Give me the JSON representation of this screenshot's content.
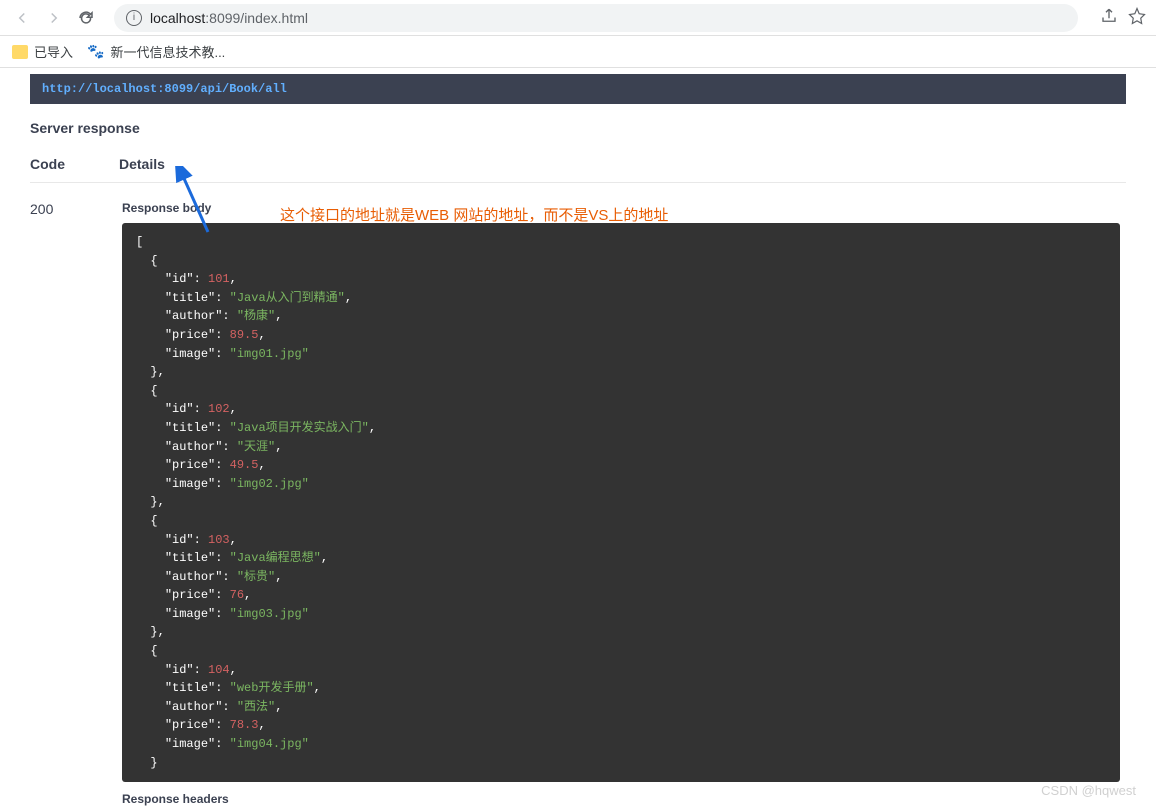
{
  "browser": {
    "address_prefix": "localhost",
    "address_suffix": ":8099/index.html"
  },
  "bookmarks": {
    "import": "已导入",
    "item1": "新一代信息技术教..."
  },
  "request": {
    "url": "http://localhost:8099/api/Book/all"
  },
  "annotation": {
    "text": "这个接口的地址就是WEB 网站的地址，而不是VS上的地址"
  },
  "labels": {
    "server_response": "Server response",
    "code": "Code",
    "details": "Details",
    "response_body": "Response body",
    "response_headers": "Response headers"
  },
  "response": {
    "code": "200",
    "items": [
      {
        "id": 101,
        "title": "Java从入门到精通",
        "author": "杨康",
        "price": 89.5,
        "image": "img01.jpg"
      },
      {
        "id": 102,
        "title": "Java项目开发实战入门",
        "author": "天涯",
        "price": 49.5,
        "image": "img02.jpg"
      },
      {
        "id": 103,
        "title": "Java编程思想",
        "author": "标贵",
        "price": 76,
        "image": "img03.jpg"
      },
      {
        "id": 104,
        "title": "web开发手册",
        "author": "西法",
        "price": 78.3,
        "image": "img04.jpg"
      }
    ]
  },
  "watermark": "CSDN @hqwest"
}
